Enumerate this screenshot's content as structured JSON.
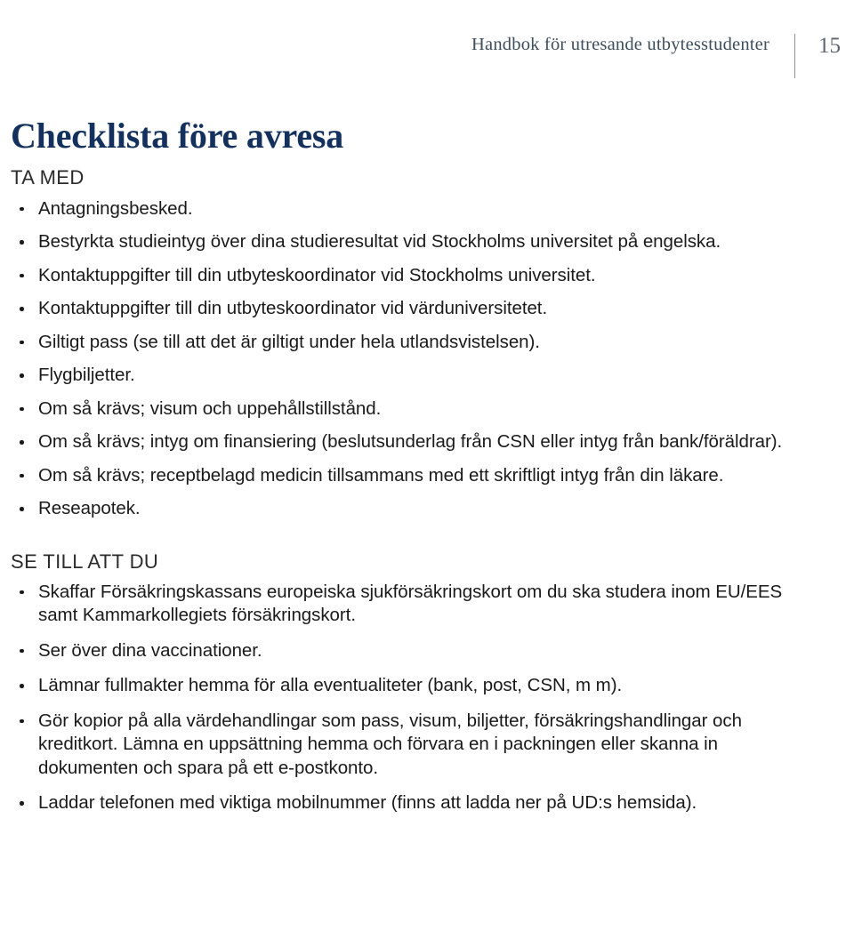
{
  "header": {
    "title": "Handbok för utresande utbytesstudenter",
    "page_number": "15",
    "title_color": "#3d4d5c",
    "divider_color": "#8b9299"
  },
  "document": {
    "title": "Checklista före avresa",
    "title_color": "#13315c",
    "body_color": "#1a1a1a"
  },
  "sections": [
    {
      "heading": "TA MED",
      "items": [
        "Antagningsbesked.",
        "Bestyrkta studieintyg över dina studieresultat vid Stockholms universitet på engelska.",
        "Kontaktuppgifter till din utbyteskoordinator vid Stockholms universitet.",
        "Kontaktuppgifter till din utbyteskoordinator vid värduniversitetet.",
        "Giltigt pass (se till att det är giltigt under hela utlandsvistelsen).",
        "Flygbiljetter.",
        "Om så krävs; visum och uppehållstillstånd.",
        "Om så krävs; intyg om finansiering (beslutsunderlag från CSN eller intyg från bank/föräldrar).",
        "Om så krävs; receptbelagd medicin tillsammans med ett skriftligt intyg från din läkare.",
        "Reseapotek."
      ]
    },
    {
      "heading": "SE TILL ATT DU",
      "items": [
        "Skaffar Försäkringskassans europeiska sjukförsäkringskort om du ska studera inom EU/EES samt Kammarkollegiets försäkringskort.",
        "Ser över dina vaccinationer.",
        "Lämnar fullmakter hemma för alla eventualiteter (bank, post, CSN, m m).",
        "Gör kopior på alla värdehandlingar som pass, visum, biljetter, försäkringshandlingar och kreditkort. Lämna en uppsättning hemma och förvara en i packningen eller skanna in dokumenten och spara på ett e-postkonto.",
        "Laddar telefonen med viktiga mobilnummer (finns att ladda ner på UD:s hemsida)."
      ]
    }
  ]
}
